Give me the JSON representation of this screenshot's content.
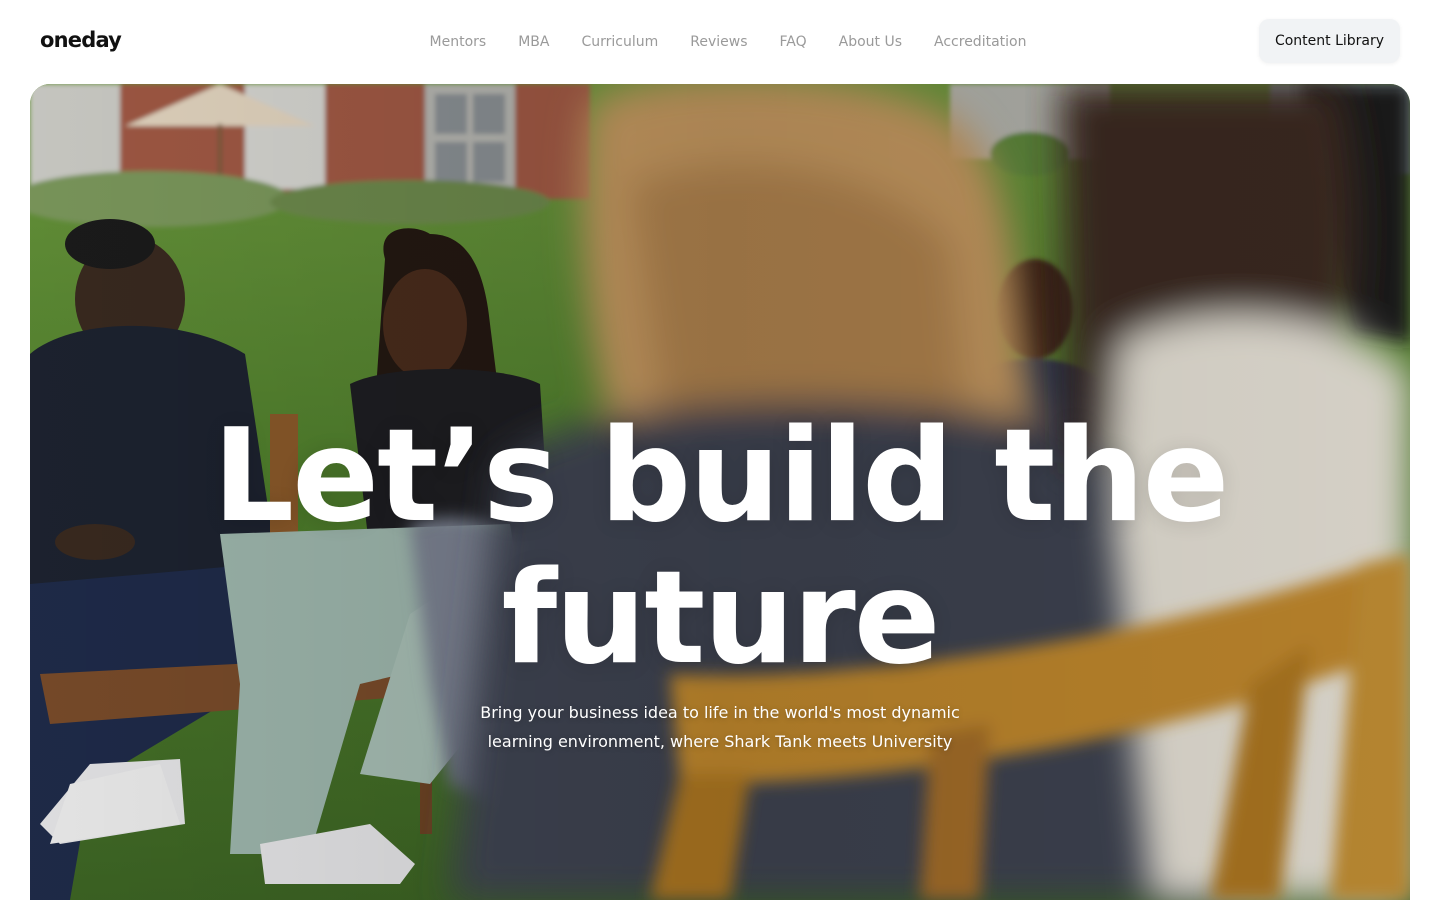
{
  "header": {
    "logo": "oneday",
    "nav": [
      {
        "label": "Mentors"
      },
      {
        "label": "MBA"
      },
      {
        "label": "Curriculum"
      },
      {
        "label": "Reviews"
      },
      {
        "label": "FAQ"
      },
      {
        "label": "About Us"
      },
      {
        "label": "Accreditation"
      }
    ],
    "cta_label": "Content Library"
  },
  "hero": {
    "headline_line1": "Let’s build the",
    "headline_line2": "future",
    "subtitle_line1": "Bring your business idea to life in the world's most dynamic",
    "subtitle_line2": "learning environment, where Shark Tank meets University",
    "image_alt": "People seated in a circle on chairs on a grass lawn"
  },
  "colors": {
    "nav_text": "#9a9a9a",
    "cta_bg": "#f1f3f5",
    "hero_text": "#ffffff"
  }
}
